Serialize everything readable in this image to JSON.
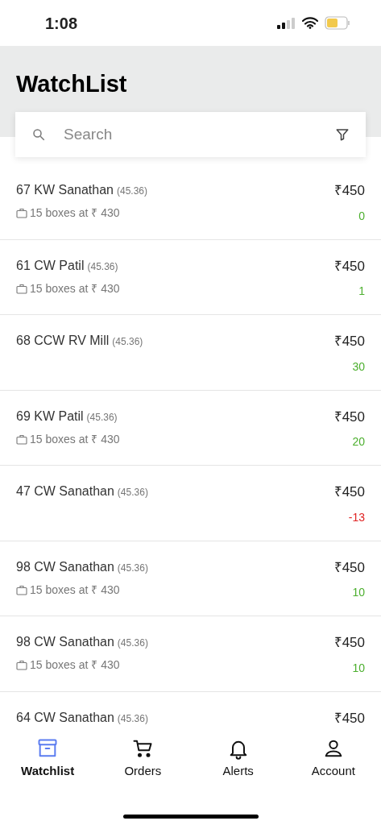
{
  "status_bar": {
    "time": "1:08"
  },
  "header": {
    "title": "WatchList"
  },
  "search": {
    "placeholder": "Search"
  },
  "items": [
    {
      "name": "67 KW Sanathan",
      "ratio": "(45.36)",
      "stock": "15 boxes at ₹ 430",
      "price": "₹450",
      "change": "0",
      "color": "#4caf2e"
    },
    {
      "name": "61 CW Patil",
      "ratio": "(45.36)",
      "stock": "15 boxes at ₹ 430",
      "price": "₹450",
      "change": "1",
      "color": "#4caf2e"
    },
    {
      "name": "68 CCW RV Mill",
      "ratio": "(45.36)",
      "price": "₹450",
      "change": "30",
      "color": "#4caf2e"
    },
    {
      "name": "69 KW Patil",
      "ratio": "(45.36)",
      "stock": "15 boxes at ₹ 430",
      "price": "₹450",
      "change": "20",
      "color": "#4caf2e"
    },
    {
      "name": "47 CW Sanathan",
      "ratio": "(45.36)",
      "price": "₹450",
      "change": "-13",
      "color": "#e02424"
    },
    {
      "name": "98 CW Sanathan",
      "ratio": "(45.36)",
      "stock": "15 boxes at ₹ 430",
      "price": "₹450",
      "change": "10",
      "color": "#4caf2e"
    },
    {
      "name": "98 CW Sanathan",
      "ratio": "(45.36)",
      "stock": "15 boxes at ₹ 430",
      "price": "₹450",
      "change": "10",
      "color": "#4caf2e"
    },
    {
      "name": "64 CW Sanathan",
      "ratio": "(45.36)",
      "price": "₹450"
    }
  ],
  "tabs": [
    {
      "kind": "watchlist",
      "label": "Watchlist",
      "selected": true
    },
    {
      "kind": "orders",
      "label": "Orders",
      "selected": false
    },
    {
      "kind": "alerts",
      "label": "Alerts",
      "selected": false
    },
    {
      "kind": "account",
      "label": "Account",
      "selected": false
    }
  ]
}
